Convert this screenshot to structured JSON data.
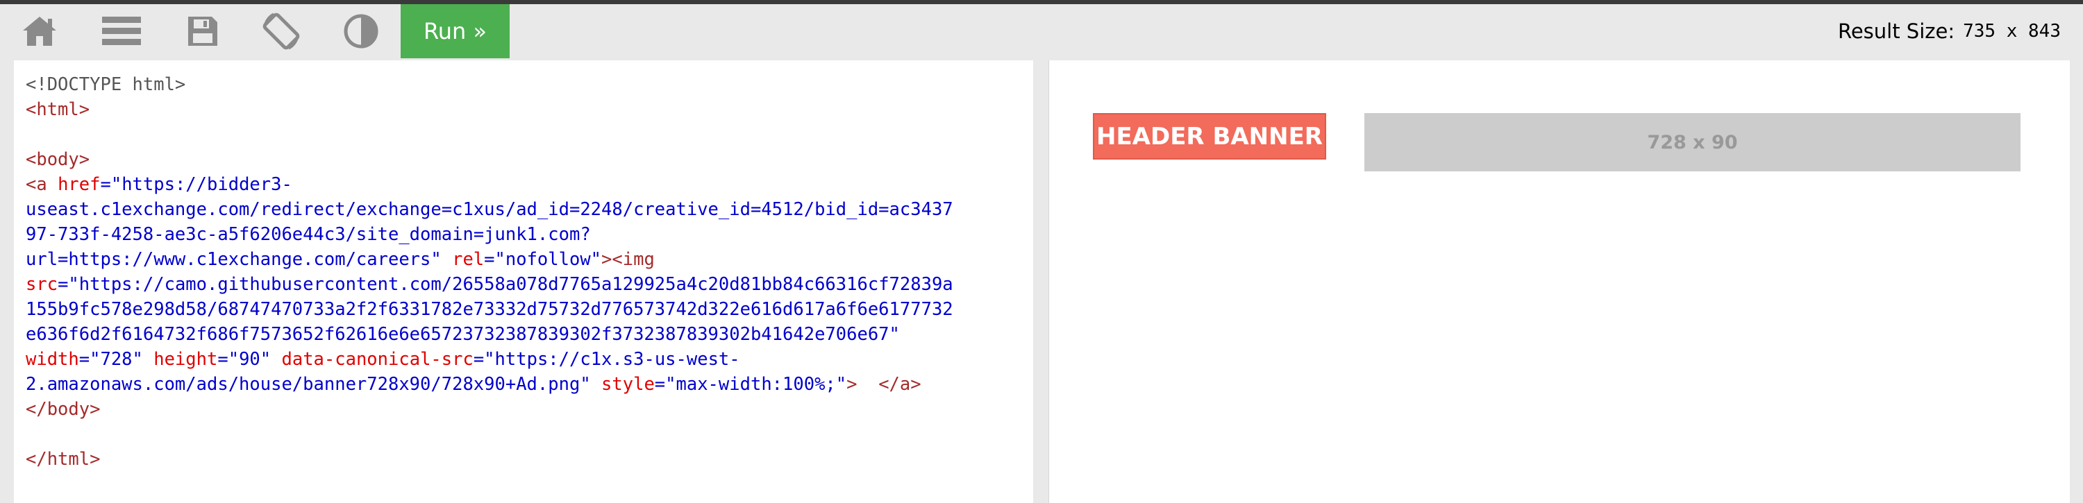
{
  "toolbar": {
    "home_icon": "home-icon",
    "menu_icon": "hamburger-menu-icon",
    "save_icon": "floppy-disk-icon",
    "rotate_icon": "rotate-device-icon",
    "theme_icon": "contrast-icon",
    "run_label": "Run »",
    "run_color": "#4caf50"
  },
  "result_size": {
    "label": "Result Size:",
    "value": "735 x 843"
  },
  "code_lines": [
    [
      {
        "t": "<!DOCTYPE html>",
        "c": "c-doc"
      }
    ],
    [
      {
        "t": "<html>",
        "c": "c-tag"
      }
    ],
    [],
    [
      {
        "t": "<body>",
        "c": "c-tag"
      }
    ],
    [
      {
        "t": "<a ",
        "c": "c-tag"
      },
      {
        "t": "href",
        "c": "c-attr"
      },
      {
        "t": "=\"https://bidder3-",
        "c": "c-val"
      }
    ],
    [
      {
        "t": "useast.c1exchange.com/redirect/exchange=c1xus/ad_id=2248/creative_id=4512/bid_id=ac3437",
        "c": "c-val"
      }
    ],
    [
      {
        "t": "97-733f-4258-ae3c-a5f6206e44c3/site_domain=junk1.com?",
        "c": "c-val"
      }
    ],
    [
      {
        "t": "url=https://www.c1exchange.com/careers\" ",
        "c": "c-val"
      },
      {
        "t": "rel",
        "c": "c-attr"
      },
      {
        "t": "=\"nofollow\"",
        "c": "c-val"
      },
      {
        "t": "><img",
        "c": "c-tag"
      }
    ],
    [
      {
        "t": "src",
        "c": "c-attr"
      },
      {
        "t": "=\"https://camo.githubusercontent.com/26558a078d7765a129925a4c20d81bb84c66316cf72839a",
        "c": "c-val"
      }
    ],
    [
      {
        "t": "155b9fc578e298d58/68747470733a2f2f6331782e73332d75732d776573742d322e616d617a6f6e6177732",
        "c": "c-val"
      }
    ],
    [
      {
        "t": "e636f6d2f6164732f686f7573652f62616e6e65723732387839302f3732387839302b41642e706e67\"",
        "c": "c-val"
      }
    ],
    [
      {
        "t": "width",
        "c": "c-attr"
      },
      {
        "t": "=\"728\" ",
        "c": "c-val"
      },
      {
        "t": "height",
        "c": "c-attr"
      },
      {
        "t": "=\"90\" ",
        "c": "c-val"
      },
      {
        "t": "data-canonical-src",
        "c": "c-attr"
      },
      {
        "t": "=\"https://c1x.s3-us-west-",
        "c": "c-val"
      }
    ],
    [
      {
        "t": "2.amazonaws.com/ads/house/banner728x90/728x90+Ad.png\" ",
        "c": "c-val"
      },
      {
        "t": "style",
        "c": "c-attr"
      },
      {
        "t": "=\"max-width:100%;\"",
        "c": "c-val"
      },
      {
        "t": ">  ",
        "c": "c-tag"
      },
      {
        "t": "</a>",
        "c": "c-tag"
      }
    ],
    [
      {
        "t": "</body>",
        "c": "c-tag"
      }
    ],
    [],
    [
      {
        "t": "</html>",
        "c": "c-tag"
      }
    ]
  ],
  "preview": {
    "logo_text": "HEADER BANNER",
    "ad_text": "728 x 90",
    "logo_color": "#f26b5b",
    "ad_color": "#cccccc"
  }
}
